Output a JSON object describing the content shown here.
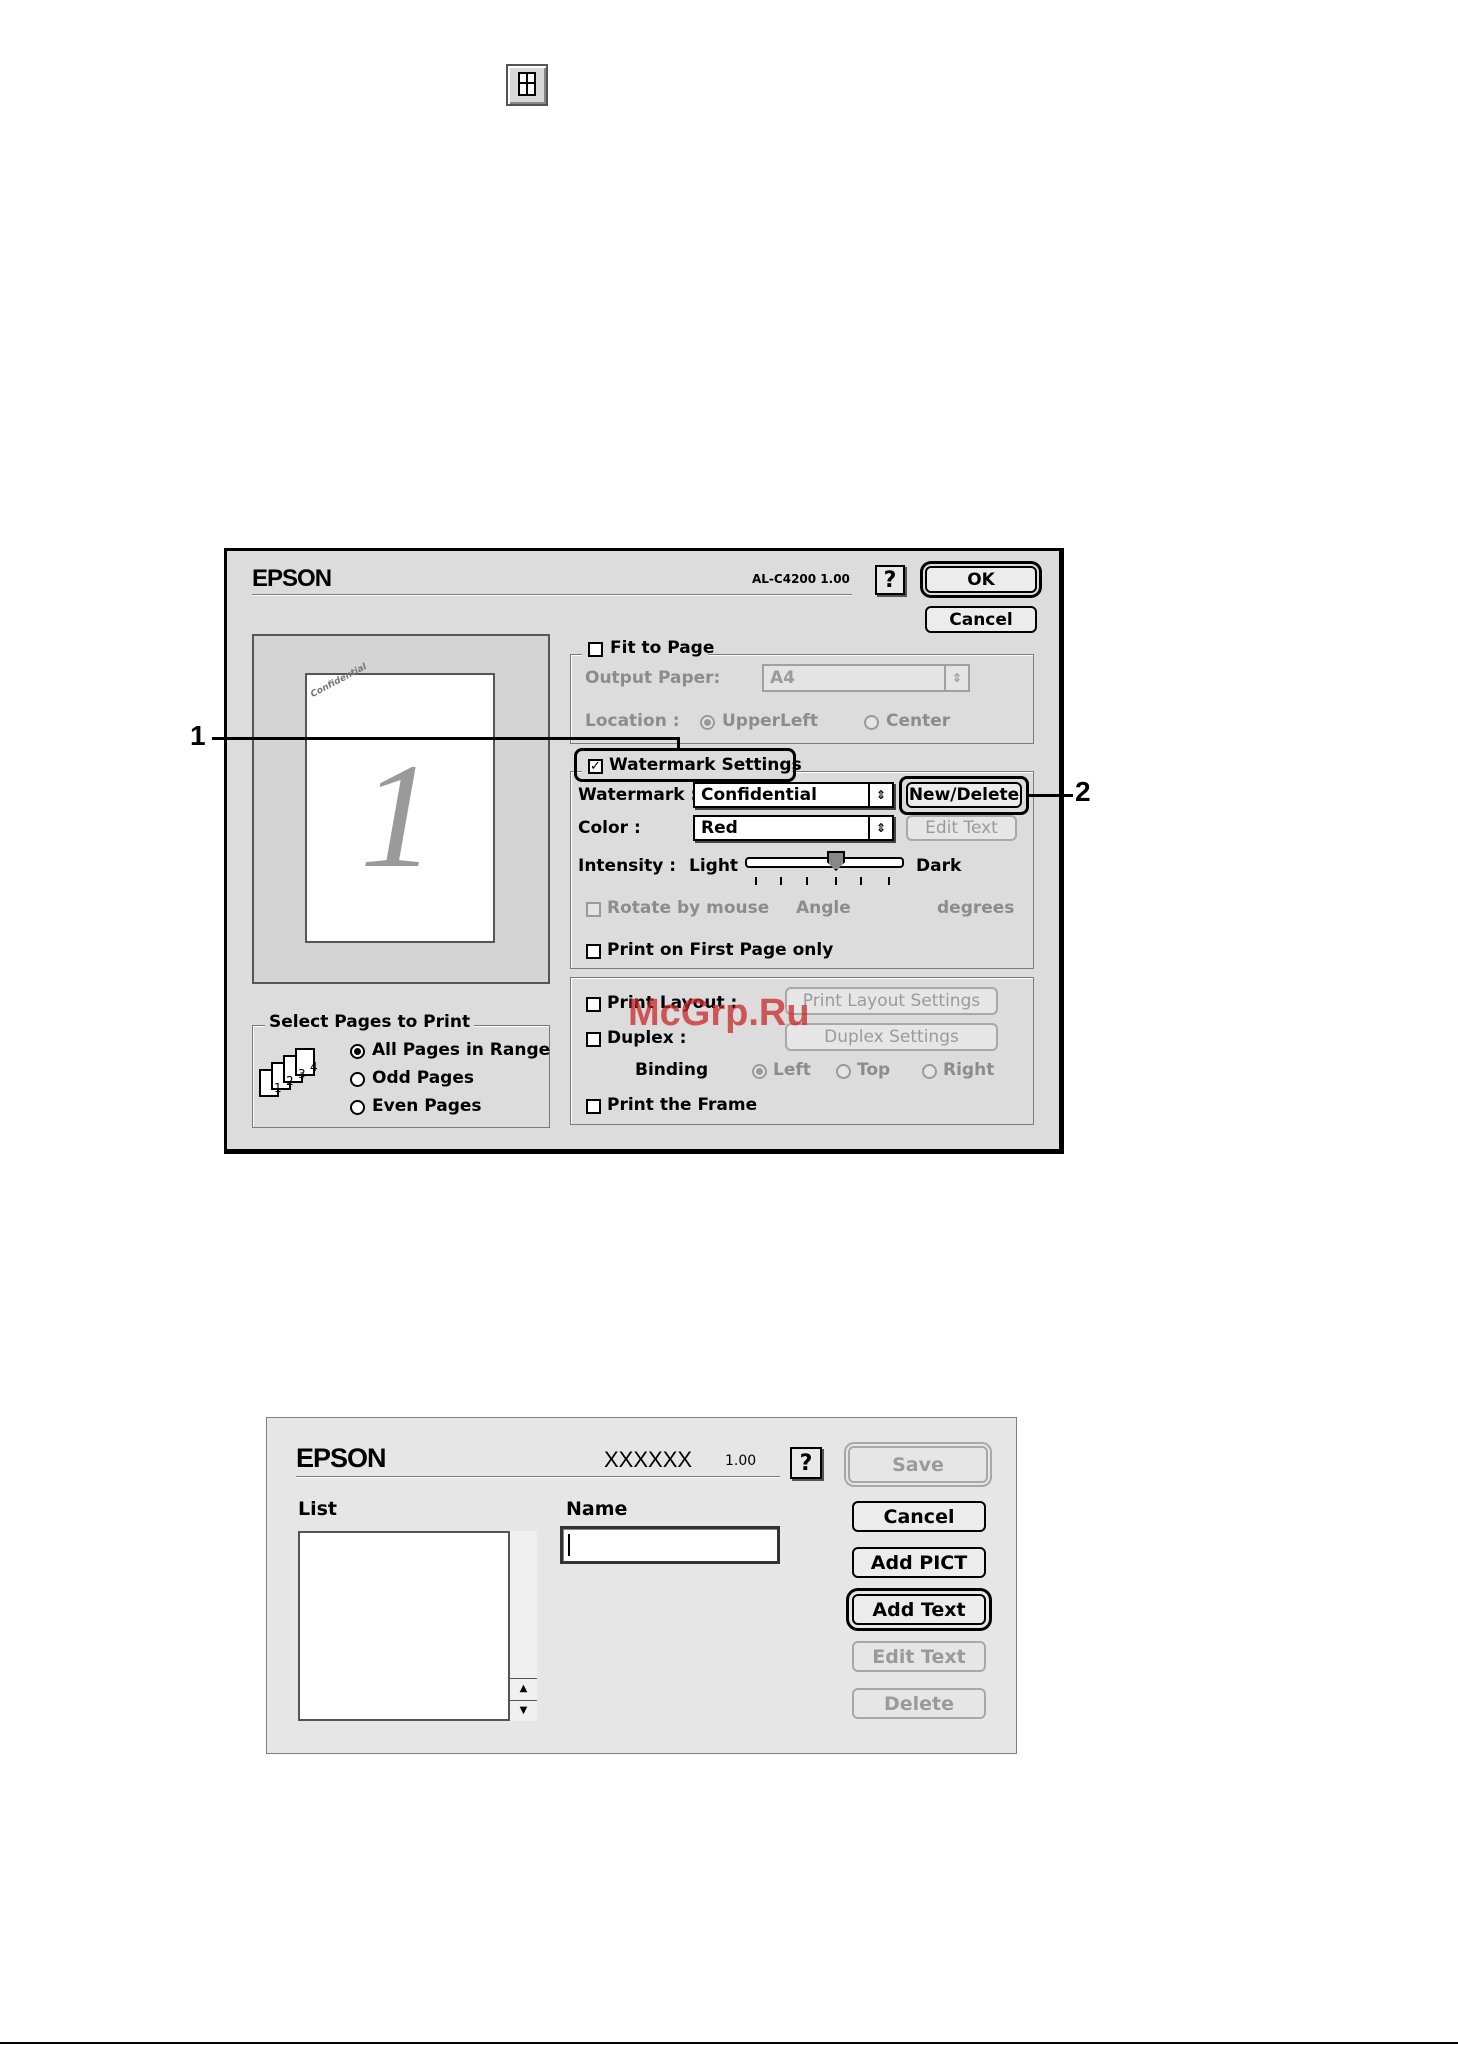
{
  "toolbar_icon": "page-layout-icon",
  "watermark_text": "McGrp.Ru",
  "dialog1": {
    "logo": "EPSON",
    "model": "AL-C4200 1.00",
    "help": "?",
    "ok": "OK",
    "cancel": "Cancel",
    "preview_page_number": "1",
    "preview_watermark": "Confidential",
    "fit_to_page": {
      "label": "Fit to Page",
      "checked": false,
      "output_paper_label": "Output Paper:",
      "output_paper_value": "A4",
      "location_label": "Location :",
      "location_options": [
        "UpperLeft",
        "Center"
      ],
      "location_selected": "UpperLeft"
    },
    "watermark": {
      "label": "Watermark Settings",
      "checked": true,
      "watermark_label": "Watermark :",
      "watermark_value": "Confidential",
      "new_delete": "New/Delete",
      "color_label": "Color :",
      "color_value": "Red",
      "edit_text": "Edit Text",
      "intensity_label": "Intensity :",
      "light": "Light",
      "dark": "Dark",
      "intensity_level": 0.5,
      "rotate_by_mouse": "Rotate by mouse",
      "angle": "Angle",
      "degrees": "degrees",
      "first_page_only": "Print on First Page only"
    },
    "layout": {
      "print_layout": "Print Layout :",
      "print_layout_settings": "Print Layout Settings",
      "duplex": "Duplex :",
      "duplex_settings": "Duplex Settings",
      "binding": "Binding",
      "binding_options": [
        "Left",
        "Top",
        "Right"
      ],
      "binding_selected": "Left",
      "print_frame": "Print the Frame"
    },
    "select_pages": {
      "title": "Select Pages to Print",
      "options": [
        "All Pages in Range",
        "Odd Pages",
        "Even Pages"
      ],
      "selected": "All Pages in Range",
      "icon_pages": [
        "1",
        "2",
        "3",
        "4"
      ]
    },
    "callouts": [
      "1",
      "2"
    ]
  },
  "dialog2": {
    "logo": "EPSON",
    "model": "XXXXXX",
    "version": "1.00",
    "help": "?",
    "list_label": "List",
    "name_label": "Name",
    "name_value": "",
    "buttons": {
      "save": "Save",
      "cancel": "Cancel",
      "add_pict": "Add PICT",
      "add_text": "Add Text",
      "edit_text": "Edit Text",
      "delete": "Delete"
    }
  }
}
